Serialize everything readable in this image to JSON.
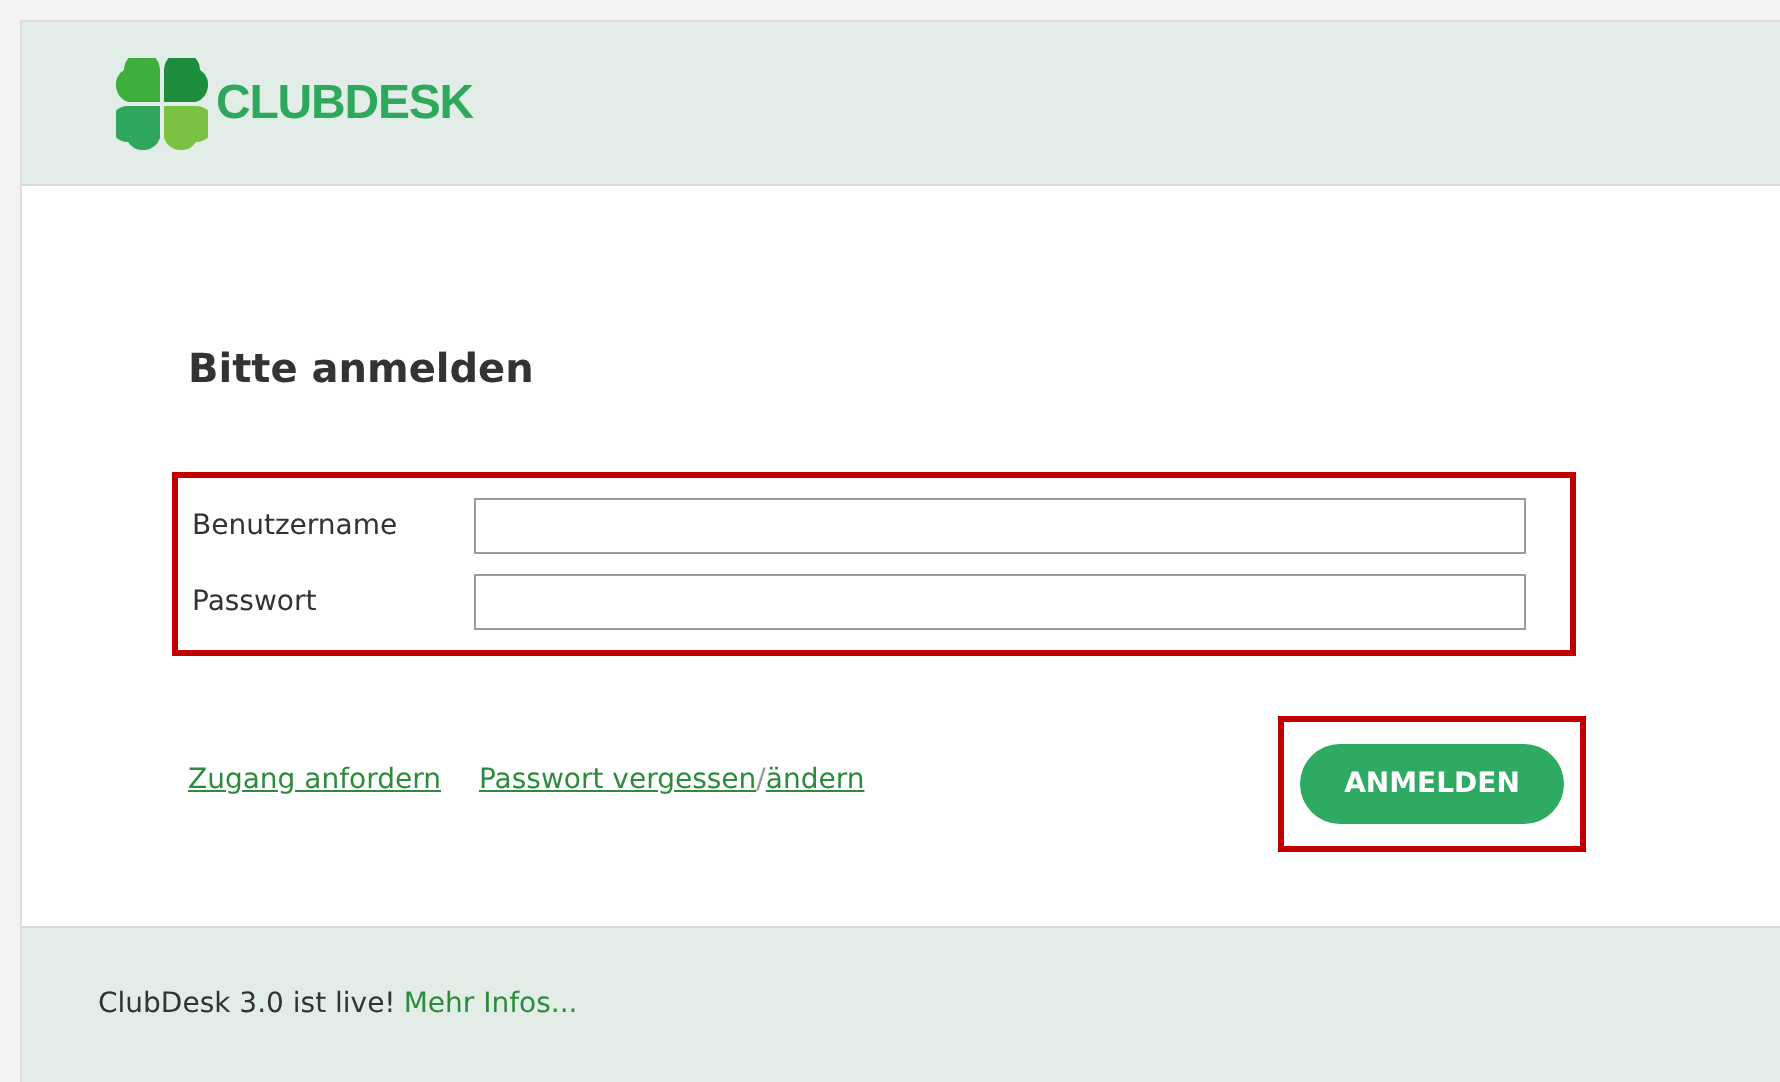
{
  "logo": {
    "text": "CLUBDESK"
  },
  "heading": "Bitte anmelden",
  "fields": [
    {
      "label": "Benutzername"
    },
    {
      "label": "Passwort"
    }
  ],
  "links": [
    {
      "text": "Zugang anfordern"
    }
  ],
  "password_links": {
    "first": "Passwort vergessen",
    "separator": "/",
    "second": "ändern"
  },
  "login_button": "ANMELDEN",
  "footer": {
    "text": "ClubDesk 3.0 ist live!",
    "link": "Mehr Infos..."
  }
}
